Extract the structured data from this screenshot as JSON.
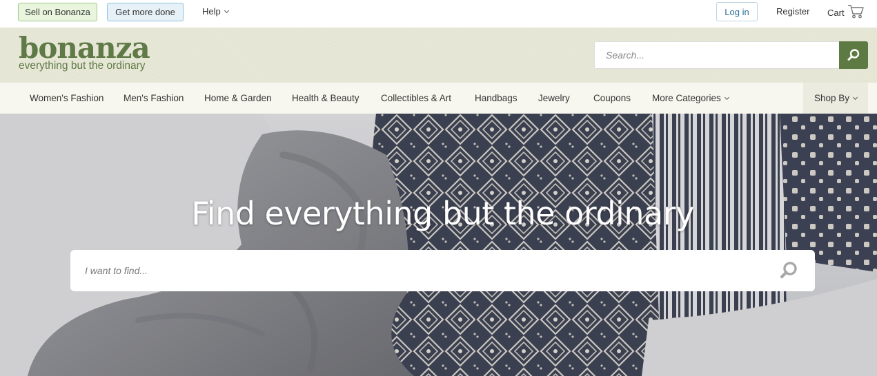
{
  "topbar": {
    "sell_label": "Sell on Bonanza",
    "more_label": "Get more done",
    "help_label": "Help",
    "login_label": "Log in",
    "register_label": "Register",
    "cart_label": "Cart"
  },
  "header": {
    "logo_word": "bonanza",
    "logo_tagline": "everything but the ordinary",
    "search_placeholder": "Search..."
  },
  "nav": {
    "categories": [
      "Women's Fashion",
      "Men's Fashion",
      "Home & Garden",
      "Health & Beauty",
      "Collectibles & Art",
      "Handbags",
      "Jewelry",
      "Coupons",
      "More Categories"
    ],
    "shop_by_label": "Shop By"
  },
  "hero": {
    "title": "Find everything but the ordinary",
    "search_placeholder": "I want to find..."
  },
  "colors": {
    "brand_green": "#5f7a46",
    "search_button": "#5d7a43",
    "header_bg": "#e8e8d7",
    "nav_bg": "#f7f7ef",
    "login_text": "#2a6f97"
  },
  "icons": {
    "cart": "cart-icon",
    "search": "search-icon",
    "chevron": "chevron-down-icon"
  }
}
